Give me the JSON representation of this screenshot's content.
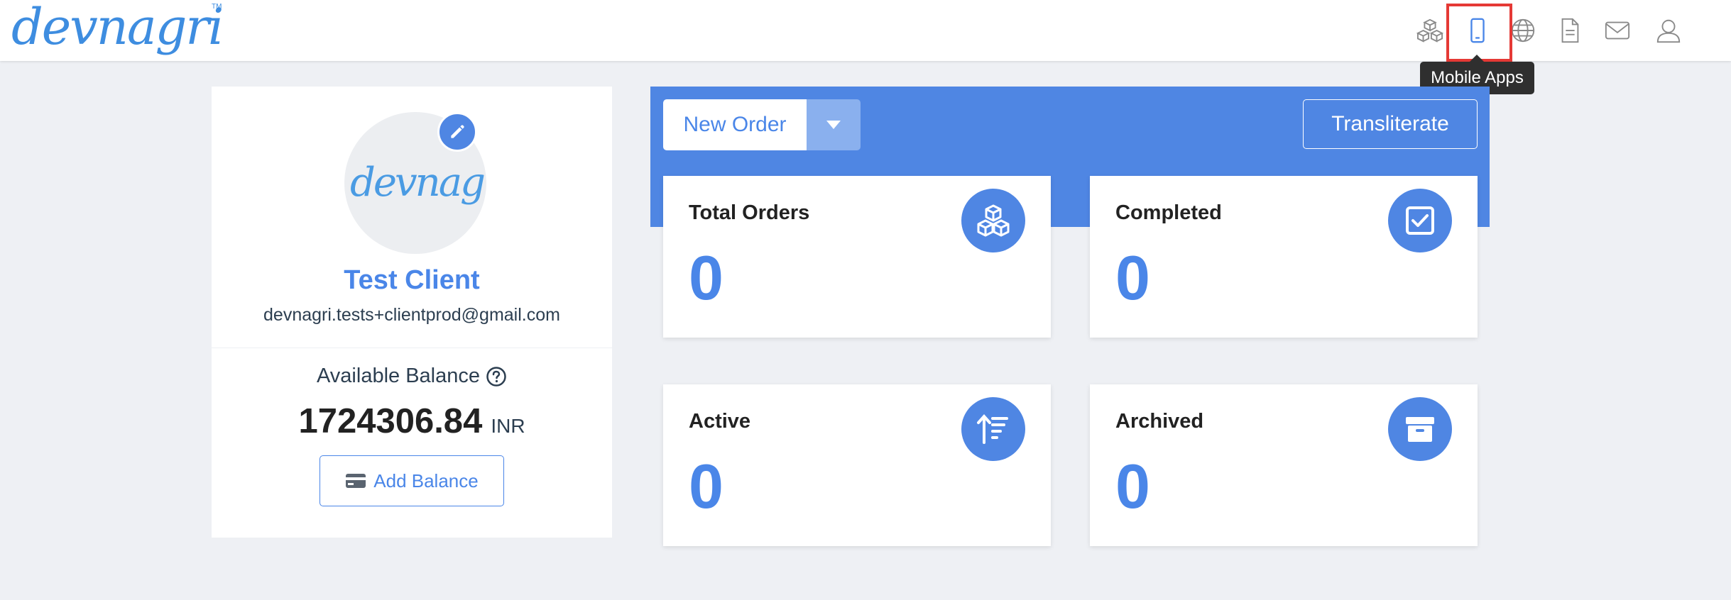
{
  "brand": {
    "logo_text": "devnagri"
  },
  "navbar": {
    "icons": [
      {
        "name": "cubes-icon",
        "label": "Orders"
      },
      {
        "name": "mobile-icon",
        "label": "Mobile Apps"
      },
      {
        "name": "globe-icon",
        "label": "Websites"
      },
      {
        "name": "document-icon",
        "label": "Documents"
      },
      {
        "name": "mail-icon",
        "label": "Messages"
      },
      {
        "name": "user-icon",
        "label": "Profile"
      }
    ],
    "tooltip": "Mobile Apps"
  },
  "profile": {
    "name": "Test Client",
    "email": "devnagri.tests+clientprod@gmail.com",
    "balance_label": "Available Balance",
    "balance_amount": "1724306.84",
    "balance_currency": "INR",
    "add_balance_label": "Add Balance"
  },
  "actions": {
    "new_order_label": "New Order",
    "transliterate_label": "Transliterate"
  },
  "stats": [
    {
      "title": "Total Orders",
      "value": "0",
      "icon": "cubes-icon"
    },
    {
      "title": "Completed",
      "value": "0",
      "icon": "check-square-icon"
    },
    {
      "title": "Active",
      "value": "0",
      "icon": "sort-up-icon"
    },
    {
      "title": "Archived",
      "value": "0",
      "icon": "archive-icon"
    }
  ],
  "colors": {
    "accent": "#4f86e3",
    "accent_text": "#4a86e8",
    "highlight": "#e53935",
    "background": "#eef0f4"
  }
}
